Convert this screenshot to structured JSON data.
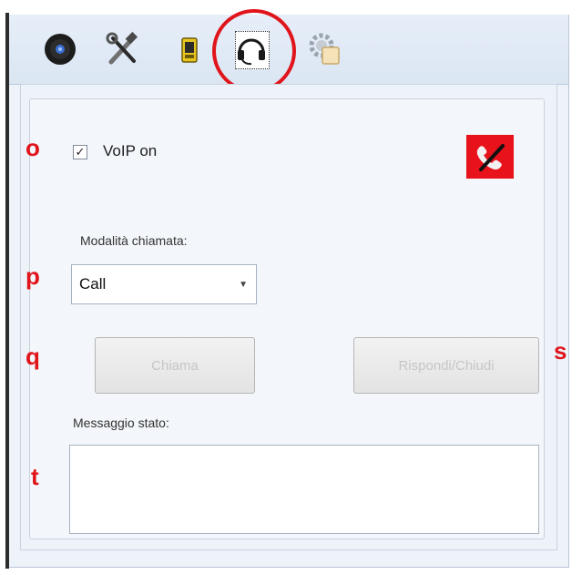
{
  "toolbar": {
    "buttons": [
      {
        "icon": "speaker-icon"
      },
      {
        "icon": "tools-icon"
      },
      {
        "icon": "device-icon"
      },
      {
        "icon": "headset-icon",
        "selected": true
      },
      {
        "icon": "settings-gear-icon"
      }
    ]
  },
  "annotations": {
    "o": "o",
    "p": "p",
    "q": "q",
    "s": "s",
    "t": "t"
  },
  "voip": {
    "checked": true,
    "check_glyph": "✓",
    "label": "VoIP on",
    "status_icon": "phone-disconnected-icon"
  },
  "call_mode": {
    "label": "Modalità chiamata:",
    "value": "Call"
  },
  "buttons": {
    "call_label": "Chiama",
    "answer_label": "Rispondi/Chiudi"
  },
  "status": {
    "label": "Messaggio stato:",
    "value": ""
  },
  "colors": {
    "annotation": "#e0141b",
    "status_bg": "#e8121b"
  }
}
